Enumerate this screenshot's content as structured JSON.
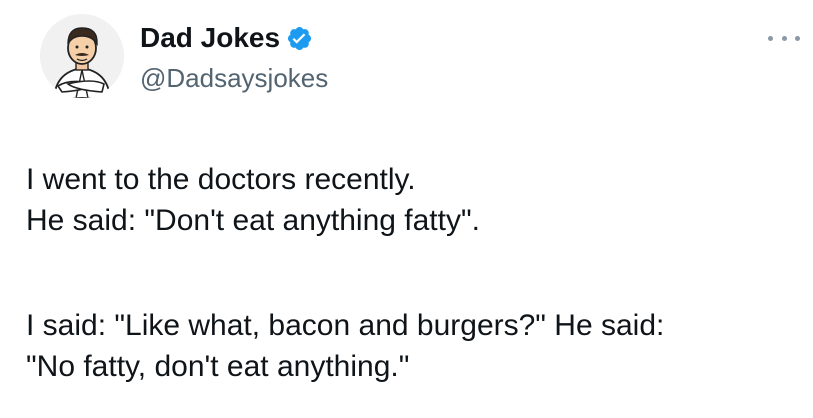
{
  "tweet": {
    "author": {
      "display_name": "Dad Jokes",
      "handle": "@Dadsaysjokes",
      "verified_icon": "verified-badge-icon",
      "avatar_icon": "cartoon-chef-avatar"
    },
    "more_icon": "more-options-icon",
    "text_lines": [
      "I went to the doctors recently.",
      "He said: \"Don't eat anything fatty\".",
      "I said: \"Like what, bacon and burgers?\" He said:",
      "\"No fatty, don't eat anything.\""
    ]
  },
  "colors": {
    "text": "#0f1419",
    "secondary": "#536471",
    "verified_blue": "#1d9bf0",
    "background": "#ffffff"
  }
}
